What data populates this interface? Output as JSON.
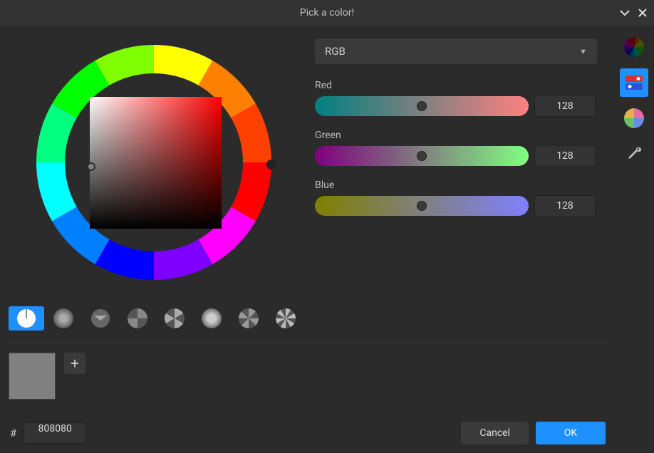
{
  "title": "Pick a color!",
  "mode": {
    "label": "RGB"
  },
  "channels": [
    {
      "label": "Red",
      "value": "128",
      "pos": 50,
      "grad": "linear-gradient(to right, #008080, #808080, #ff8080)"
    },
    {
      "label": "Green",
      "value": "128",
      "pos": 50,
      "grad": "linear-gradient(to right, #800080, #808080, #80ff80)"
    },
    {
      "label": "Blue",
      "value": "128",
      "pos": 50,
      "grad": "linear-gradient(to right, #808000, #808080, #8080ff)"
    }
  ],
  "hex": {
    "prefix": "#",
    "value": "808080"
  },
  "buttons": {
    "cancel": "Cancel",
    "ok": "OK"
  },
  "palette": {
    "add": "+",
    "swatch_color": "#808080"
  },
  "selected_color": "#808080"
}
